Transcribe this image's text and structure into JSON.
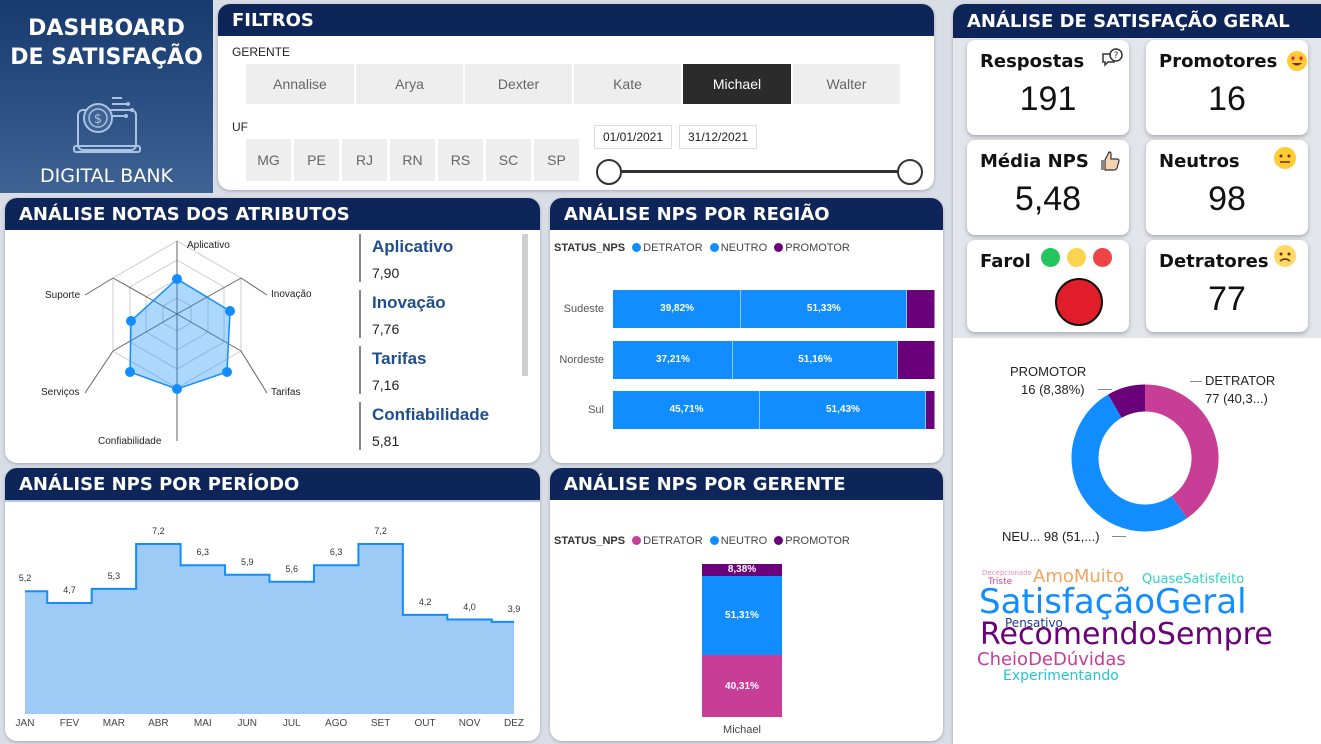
{
  "logo": {
    "title_line1": "DASHBOARD",
    "title_line2": "DE SATISFAÇÃO",
    "brand": "DIGITAL BANK"
  },
  "filters": {
    "header": "FILTROS",
    "gerente_label": "GERENTE",
    "gerentes": [
      "Annalise",
      "Arya",
      "Dexter",
      "Kate",
      "Michael",
      "Walter"
    ],
    "selected_gerente": "Michael",
    "uf_label": "UF",
    "ufs": [
      "MG",
      "PE",
      "RJ",
      "RN",
      "RS",
      "SC",
      "SP"
    ],
    "date_start": "01/01/2021",
    "date_end": "31/12/2021"
  },
  "attributes": {
    "header": "ANÁLISE NOTAS DOS ATRIBUTOS",
    "axes": [
      "Aplicativo",
      "Inovação",
      "Tarifas",
      "Confiabilidade",
      "Serviços",
      "Suporte"
    ],
    "list": [
      {
        "name": "Aplicativo",
        "value": "7,90"
      },
      {
        "name": "Inovação",
        "value": "7,76"
      },
      {
        "name": "Tarifas",
        "value": "7,16"
      },
      {
        "name": "Confiabilidade",
        "value": "5,81"
      }
    ]
  },
  "region": {
    "header": "ANÁLISE NPS POR REGIÃO",
    "legend_title": "STATUS_NPS",
    "legend": [
      "DETRATOR",
      "NEUTRO",
      "PROMOTOR"
    ],
    "rows": [
      {
        "name": "Sudeste",
        "detrator": "39,82%",
        "neutro": "51,33%"
      },
      {
        "name": "Nordeste",
        "detrator": "37,21%",
        "neutro": "51,16%"
      },
      {
        "name": "Sul",
        "detrator": "45,71%",
        "neutro": "51,43%"
      }
    ]
  },
  "period": {
    "header": "ANÁLISE NPS POR PERÍODO",
    "months": [
      "JAN",
      "FEV",
      "MAR",
      "ABR",
      "MAI",
      "JUN",
      "JUL",
      "AGO",
      "SET",
      "OUT",
      "NOV",
      "DEZ"
    ],
    "values": [
      "5,2",
      "4,7",
      "5,3",
      "7,2",
      "6,3",
      "5,9",
      "5,6",
      "6,3",
      "7,2",
      "4,2",
      "4,0",
      "3,9"
    ]
  },
  "manager": {
    "header": "ANÁLISE NPS POR GERENTE",
    "legend_title": "STATUS_NPS",
    "legend": [
      "DETRATOR",
      "NEUTRO",
      "PROMOTOR"
    ],
    "promotor": "8,38%",
    "neutro": "51,31%",
    "detrator": "40,31%",
    "category": "Michael"
  },
  "overall": {
    "header": "ANÁLISE DE SATISFAÇÃO GERAL",
    "respostas_label": "Respostas",
    "respostas": "191",
    "promotores_label": "Promotores",
    "promotores": "16",
    "media_label": "Média NPS",
    "media": "5,48",
    "neutros_label": "Neutros",
    "neutros": "98",
    "farol_label": "Farol",
    "detratores_label": "Detratores",
    "detratores": "77",
    "donut_promotor_name": "PROMOTOR",
    "donut_promotor_val": "16 (8,38%)",
    "donut_detrator_name": "DETRATOR",
    "donut_detrator_val": "77 (40,3...)",
    "donut_neutro": "NEU... 98 (51,...)"
  },
  "wordcloud": {
    "w1": "Decepcionado",
    "w2": "Triste",
    "w3": "AmoMuito",
    "w4": "QuaseSatisfeito",
    "w5": "SatisfaçãoGeral",
    "w6": "Pensativo",
    "w7": "RecomendoSempre",
    "w8": "CheioDeDúvidas",
    "w9": "Experimentando"
  },
  "colors": {
    "navy": "#0d2559",
    "neutro": "#118dff",
    "detrator_region": "#118dff",
    "promotor": "#6b007b",
    "detrator": "#c83d95",
    "area": "#9ecbf5"
  },
  "chart_data": [
    {
      "type": "line",
      "title": "ANÁLISE NPS POR PERÍODO",
      "x": [
        "JAN",
        "FEV",
        "MAR",
        "ABR",
        "MAI",
        "JUN",
        "JUL",
        "AGO",
        "SET",
        "OUT",
        "NOV",
        "DEZ"
      ],
      "values": [
        5.2,
        4.7,
        5.3,
        7.2,
        6.3,
        5.9,
        5.6,
        6.3,
        7.2,
        4.2,
        4.0,
        3.9
      ]
    },
    {
      "type": "bar",
      "title": "ANÁLISE NPS POR REGIÃO",
      "categories": [
        "Sudeste",
        "Nordeste",
        "Sul"
      ],
      "series": [
        {
          "name": "DETRATOR",
          "values": [
            39.82,
            37.21,
            45.71
          ]
        },
        {
          "name": "NEUTRO",
          "values": [
            51.33,
            51.16,
            51.43
          ]
        }
      ]
    },
    {
      "type": "bar",
      "title": "ANÁLISE NPS POR GERENTE",
      "categories": [
        "Michael"
      ],
      "series": [
        {
          "name": "DETRATOR",
          "values": [
            40.31
          ]
        },
        {
          "name": "NEUTRO",
          "values": [
            51.31
          ]
        },
        {
          "name": "PROMOTOR",
          "values": [
            8.38
          ]
        }
      ]
    },
    {
      "type": "pie",
      "categories": [
        "DETRATOR",
        "NEUTRO",
        "PROMOTOR"
      ],
      "values": [
        77,
        98,
        16
      ]
    }
  ]
}
